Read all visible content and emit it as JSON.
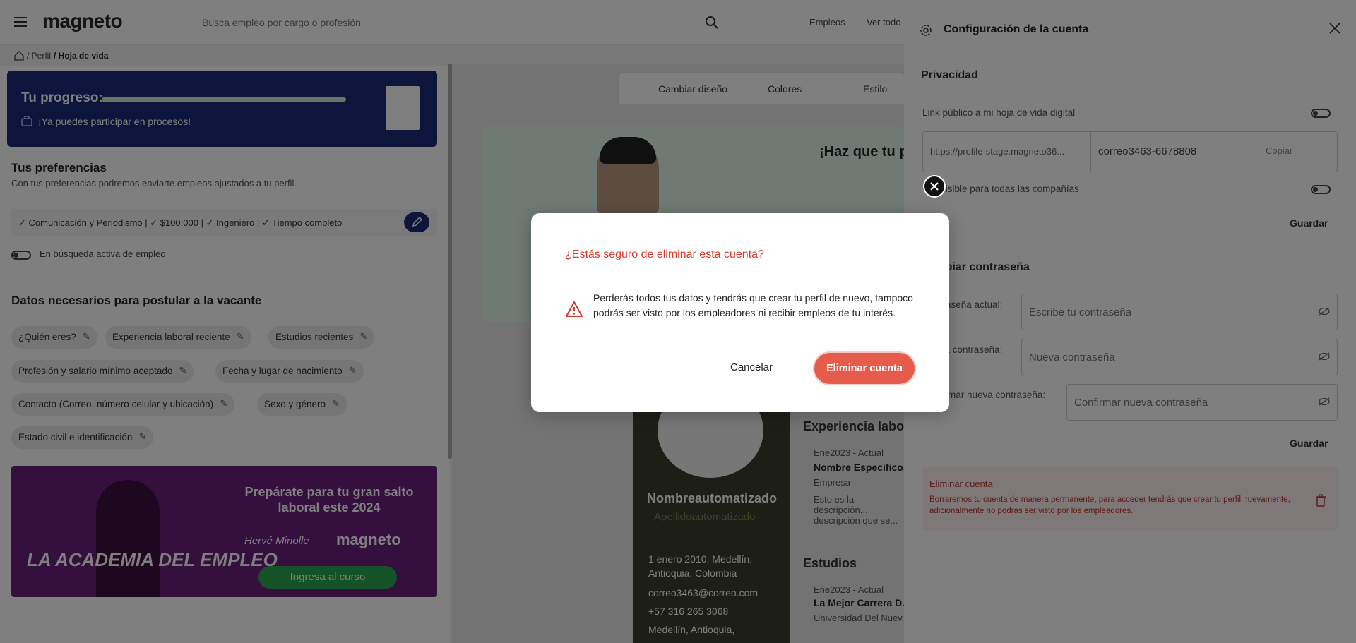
{
  "header": {
    "logo": "magneto",
    "search_placeholder": "Busca empleo por cargo o profesión",
    "links": [
      "Empleos",
      "Ver todo"
    ]
  },
  "breadcrumb": {
    "items": [
      "/ Perfil",
      "/ Hoja de vida"
    ]
  },
  "progress": {
    "title": "Tu progreso:",
    "message": "¡Ya puedes participar en procesos!",
    "value": 1.0
  },
  "preferences": {
    "title": "Tus preferencias",
    "subtitle": "Con tus preferencias podremos enviarte empleos ajustados a tu perfil.",
    "summary": "✓ Comunicación y Periodismo | ✓ $100.000 | ✓ Ingeniero | ✓ Tiempo completo",
    "active_search_label": "En búsqueda activa de empleo"
  },
  "datos": {
    "title": "Datos necesarios para postular a la vacante",
    "chips": [
      "¿Quién eres?",
      "Experiencia laboral reciente",
      "Estudios recientes",
      "Profesión y salario mínimo aceptado",
      "Fecha y lugar de nacimiento",
      "Contacto (Correo, número celular y ubicación)",
      "Sexo y género",
      "Estado civil e identificación"
    ]
  },
  "banner": {
    "title": "Prepárate para tu gran salto laboral este 2024",
    "brand": "magneto",
    "signature": "Hervé Minolle",
    "button": "Ingresa al curso",
    "academy": "LA ACADEMIA DEL EMPLEO"
  },
  "preview": {
    "toolbar": [
      "Cambiar diseño",
      "Colores",
      "Estilo"
    ],
    "headline": "¡Haz que tu p... complemente...",
    "name": "Nombreautomatizado",
    "last_name": "Apellidoautomatizado",
    "birth": "1 enero 2010, Medellín, Antioquia, Colombia",
    "email": "correo3463@correo.com",
    "phone": "+57 316 265 3068",
    "city": "Medellín, Antioquia,",
    "experience_title": "Experiencia labo...",
    "exp_date": "Ene2023 - Actual",
    "exp_role": "Nombre Especifico...",
    "exp_company": "Empresa",
    "exp_desc": "Esto es la descripción... descripción que se...",
    "studies_title": "Estudios",
    "study_date": "Ene2023 - Actual",
    "study_name": "La Mejor Carrera D...",
    "study_school": "Universidad Del Nuev..."
  },
  "settings": {
    "title": "Configuración de la cuenta",
    "privacy_title": "Privacidad",
    "public_link_label": "Link público a mi hoja de vida digital",
    "link_url": "https://profile-stage.magneto36...",
    "link_email": "correo3463-6678808",
    "copy_label": "Copiar",
    "visible_label": "Visible para todas las compañías",
    "save_label": "Guardar",
    "password_title": "Cambiar contraseña",
    "current_pw_label": "Contraseña actual:",
    "current_pw_placeholder": "Escribe tu contraseña",
    "new_pw_label": "Nueva contraseña:",
    "new_pw_placeholder": "Nueva contraseña",
    "confirm_pw_label": "Confirmar nueva contraseña:",
    "confirm_pw_placeholder": "Confirmar nueva contraseña",
    "save2_label": "Guardar",
    "delete_title": "Eliminar cuenta",
    "delete_desc": "Borraremos tu cuenta de manera permanente, para acceder tendrás que crear tu perfil nuevamente, adicionalmente no podrás ser visto por los empleadores."
  },
  "modal": {
    "title": "¿Estás seguro de eliminar esta cuenta?",
    "body": "Perderás todos tus datos y tendrás que crear tu perfil de nuevo, tampoco podrás ser visto por los empleadores ni recibir empleos de tu interés.",
    "cancel": "Cancelar",
    "confirm": "Eliminar cuenta"
  },
  "colors": {
    "primary_navy": "#1c2a7a",
    "brand_green": "#3cb371",
    "danger": "#e55b4c",
    "danger_text": "#d9392b"
  }
}
